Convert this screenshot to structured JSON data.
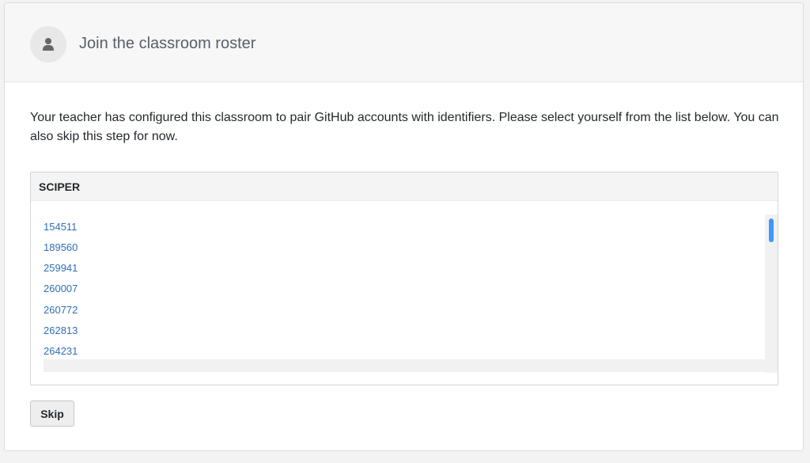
{
  "header": {
    "title": "Join the classroom roster",
    "icon": "person-icon"
  },
  "intro_text": "Your teacher has configured this classroom to pair GitHub accounts with identifiers. Please select yourself from the list below. You can also skip this step for now.",
  "roster": {
    "column_header": "SCIPER",
    "identifiers": [
      "154511",
      "189560",
      "259941",
      "260007",
      "260772",
      "262813",
      "264231"
    ]
  },
  "actions": {
    "skip_label": "Skip"
  },
  "colors": {
    "link": "#2f6fb4",
    "scroll_thumb": "#3b99fc",
    "header_bg": "#f7f7f7"
  }
}
